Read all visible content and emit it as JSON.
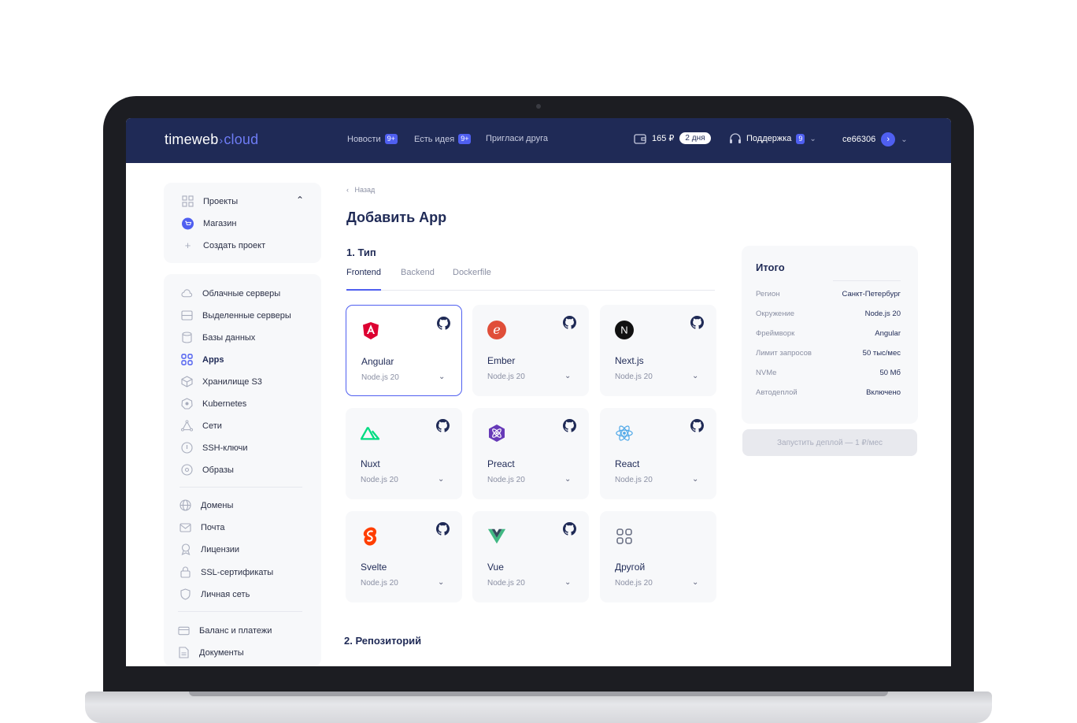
{
  "app": {
    "logo_main": "timeweb",
    "logo_sep": "›",
    "logo_sub": "cloud"
  },
  "topbar": {
    "news_label": "Новости",
    "news_badge": "9+",
    "idea_label": "Есть идея",
    "idea_badge": "9+",
    "invite_label": "Пригласи друга",
    "balance": "165 ₽",
    "balance_days": "2 дня",
    "support_label": "Поддержка",
    "support_badge": "9",
    "user_id": "ce66306"
  },
  "sidebar": {
    "group1": [
      {
        "label": "Проекты",
        "icon": "grid-icon"
      },
      {
        "label": "Магазин",
        "icon": "cart-icon"
      },
      {
        "label": "Создать проект",
        "icon": "plus-icon"
      }
    ],
    "group2": [
      {
        "label": "Облачные серверы",
        "icon": "cloud-icon"
      },
      {
        "label": "Выделенные серверы",
        "icon": "server-icon"
      },
      {
        "label": "Базы данных",
        "icon": "database-icon"
      },
      {
        "label": "Apps",
        "icon": "apps-icon",
        "active": true
      },
      {
        "label": "Хранилище S3",
        "icon": "cube-icon"
      },
      {
        "label": "Kubernetes",
        "icon": "kubernetes-icon"
      },
      {
        "label": "Сети",
        "icon": "network-icon"
      },
      {
        "label": "SSH-ключи",
        "icon": "key-icon"
      },
      {
        "label": "Образы",
        "icon": "disc-icon"
      }
    ],
    "group3": [
      {
        "label": "Домены",
        "icon": "globe-icon"
      },
      {
        "label": "Почта",
        "icon": "mail-icon"
      },
      {
        "label": "Лицензии",
        "icon": "license-icon"
      },
      {
        "label": "SSL-сертификаты",
        "icon": "lock-icon"
      },
      {
        "label": "Личная сеть",
        "icon": "shield-icon"
      }
    ],
    "group4": [
      {
        "label": "Баланс и платежи",
        "icon": "card-icon"
      },
      {
        "label": "Документы",
        "icon": "document-icon"
      }
    ]
  },
  "main": {
    "back_label": "Назад",
    "title": "Добавить App",
    "section1": "1. Тип",
    "section2": "2. Репозиторий",
    "tabs": [
      "Frontend",
      "Backend",
      "Dockerfile"
    ],
    "frameworks": [
      {
        "name": "Angular",
        "version": "Node.js 20",
        "icon": "angular-icon",
        "color": "#dd0031"
      },
      {
        "name": "Ember",
        "version": "Node.js 20",
        "icon": "ember-icon",
        "color": "#e04e39"
      },
      {
        "name": "Next.js",
        "version": "Node.js 20",
        "icon": "nextjs-icon",
        "color": "#000000"
      },
      {
        "name": "Nuxt",
        "version": "Node.js 20",
        "icon": "nuxt-icon",
        "color": "#00dc82"
      },
      {
        "name": "Preact",
        "version": "Node.js 20",
        "icon": "preact-icon",
        "color": "#673ab8"
      },
      {
        "name": "React",
        "version": "Node.js 20",
        "icon": "react-icon",
        "color": "#61dafb"
      },
      {
        "name": "Svelte",
        "version": "Node.js 20",
        "icon": "svelte-icon",
        "color": "#ff3e00"
      },
      {
        "name": "Vue",
        "version": "Node.js 20",
        "icon": "vue-icon",
        "color": "#41b883"
      },
      {
        "name": "Другой",
        "version": "Node.js 20",
        "icon": "other-icon",
        "color": "#6b7185"
      }
    ]
  },
  "summary": {
    "title": "Итого",
    "rows": [
      {
        "k": "Регион",
        "v": "Санкт-Петербург"
      },
      {
        "k": "Окружение",
        "v": "Node.js 20"
      },
      {
        "k": "Фреймворк",
        "v": "Angular"
      },
      {
        "k": "Лимит запросов",
        "v": "50 тыс/мес"
      },
      {
        "k": "NVMe",
        "v": "50 Мб"
      },
      {
        "k": "Автодеплой",
        "v": "Включено"
      }
    ],
    "deploy_label": "Запустить деплой — 1 ₽/мес"
  },
  "colors": {
    "accent": "#4f5ff0",
    "header_bg": "#1f2a56"
  }
}
